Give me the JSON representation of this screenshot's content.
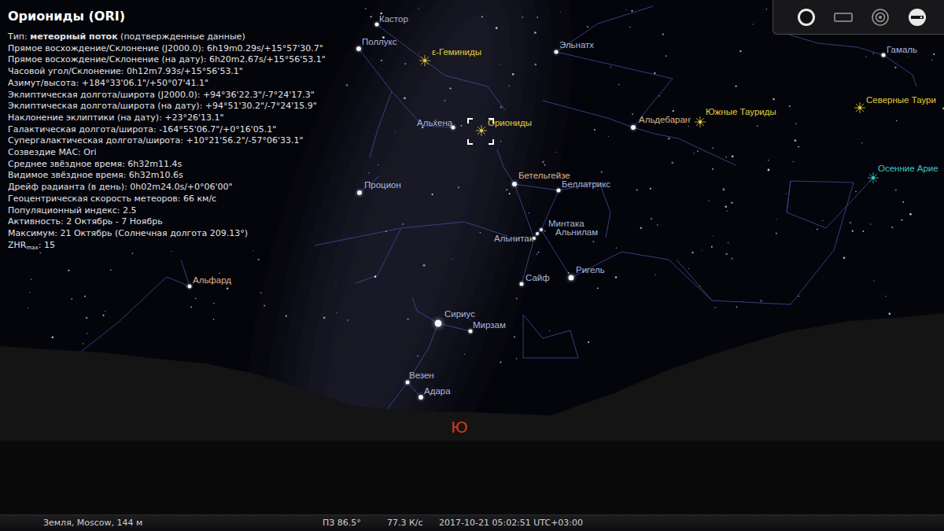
{
  "info_panel": {
    "title": "Ориониды (ORI)",
    "lines": [
      {
        "kind": "bold",
        "prefix": "Тип: ",
        "bold": "метеорный поток",
        "suffix": " (подтвержденные данные)"
      },
      {
        "kind": "plain",
        "text": "Прямое восхождение/Склонение (J2000.0): 6h19m0.29s/+15°57'30.7\""
      },
      {
        "kind": "plain",
        "text": "Прямое восхождение/Склонение (на дату): 6h20m2.67s/+15°56'53.1\""
      },
      {
        "kind": "plain",
        "text": "Часовой угол/Склонение: 0h12m7.93s/+15°56'53.1\""
      },
      {
        "kind": "plain",
        "text": "Азимут/высота: +184°33'06.1\"/+50°07'41.1\""
      },
      {
        "kind": "plain",
        "text": "Эклиптическая долгота/широта (J2000.0): +94°36'22.3\"/-7°24'17.3\""
      },
      {
        "kind": "plain",
        "text": "Эклиптическая долгота/широта (на дату): +94°51'30.2\"/-7°24'15.9\""
      },
      {
        "kind": "plain",
        "text": "Наклонение эклиптики (на дату): +23°26'13.1\""
      },
      {
        "kind": "plain",
        "text": "Галактическая долгота/широта: -164°55'06.7\"/+0°16'05.1\""
      },
      {
        "kind": "plain",
        "text": "Супергалактическая долгота/широта: +10°21'56.2\"/-57°06'33.1\""
      },
      {
        "kind": "plain",
        "text": "Созвездие МАС: Ori"
      },
      {
        "kind": "plain",
        "text": "Среднее звёздное время: 6h32m11.4s"
      },
      {
        "kind": "plain",
        "text": "Видимое звёздное время: 6h32m10.6s"
      },
      {
        "kind": "plain",
        "text": "Дрейф радианта (в день): 0h02m24.0s/+0°06'00\""
      },
      {
        "kind": "plain",
        "text": "Геоцентрическая скорость метеоров: 66 км/с"
      },
      {
        "kind": "plain",
        "text": "Популяционный индекс: 2.5"
      },
      {
        "kind": "plain",
        "text": "Активность: 2 Октябрь - 7 Ноябрь"
      },
      {
        "kind": "plain",
        "text": "Максимум: 21 Октябрь (Солнечная долгота 209.13°)"
      },
      {
        "kind": "subscript",
        "text": "ZHR",
        "sub": "max",
        "suffix": ": 15"
      }
    ]
  },
  "sky_labels": [
    {
      "text": "Кастор",
      "kind": "star",
      "color": "#a9b9d8",
      "selected": false
    },
    {
      "text": "Поллукс",
      "kind": "star",
      "color": "#a9b9d8",
      "selected": false
    },
    {
      "text": "ε-Геминиды",
      "kind": "shower",
      "color": "#e2cd3a",
      "selected": false
    },
    {
      "text": "Эльнатх",
      "kind": "star",
      "color": "#a9b9d8",
      "selected": false
    },
    {
      "text": "Гамаль",
      "kind": "star",
      "color": "#a9b9d8",
      "selected": false
    },
    {
      "text": "Северные Таури",
      "kind": "shower",
      "color": "#e2cd3a",
      "selected": false
    },
    {
      "text": "Альхена",
      "kind": "star",
      "color": "#a9b9d8",
      "selected": false
    },
    {
      "text": "Ориониды",
      "kind": "shower",
      "color": "#e2cd3a",
      "selected": true
    },
    {
      "text": "Альдебаран",
      "kind": "star",
      "color": "#dcb48a",
      "selected": false
    },
    {
      "text": "Южные Тауриды",
      "kind": "shower",
      "color": "#e2cd3a",
      "selected": false
    },
    {
      "text": "Бетельгейзе",
      "kind": "star",
      "color": "#dcb48a",
      "selected": false
    },
    {
      "text": "Беллатрикс",
      "kind": "star",
      "color": "#a9b9d8",
      "selected": false
    },
    {
      "text": "Осенние Арие",
      "kind": "shower",
      "color": "#3cc8c4",
      "selected": false
    },
    {
      "text": "Процион",
      "kind": "star",
      "color": "#a9b9d8",
      "selected": false
    },
    {
      "text": "Минтака",
      "kind": "star",
      "color": "#a9b9d8",
      "selected": false
    },
    {
      "text": "Альнилам",
      "kind": "star",
      "color": "#a9b9d8",
      "selected": false
    },
    {
      "text": "Альнитак",
      "kind": "star",
      "color": "#a9b9d8",
      "selected": false
    },
    {
      "text": "Сайф",
      "kind": "star",
      "color": "#a9b9d8",
      "selected": false
    },
    {
      "text": "Ригель",
      "kind": "star",
      "color": "#a9b9d8",
      "selected": false
    },
    {
      "text": "Альфард",
      "kind": "star",
      "color": "#dcb48a",
      "selected": false
    },
    {
      "text": "Сириус",
      "kind": "star",
      "color": "#a9b9d8",
      "selected": false
    },
    {
      "text": "Мирзам",
      "kind": "star",
      "color": "#a9b9d8",
      "selected": false
    },
    {
      "text": "Везен",
      "kind": "star",
      "color": "#a9b9d8",
      "selected": false
    },
    {
      "text": "Адара",
      "kind": "star",
      "color": "#a9b9d8",
      "selected": false
    }
  ],
  "cardinal_point": {
    "text": "Ю"
  },
  "status_bar": {
    "location": "Земля, Moscow, 144 м",
    "fov": "ПЗ 86.5°",
    "fps": "77.3 К/с",
    "datetime": "2017-10-21 05:02:51 UTC+03:00"
  }
}
